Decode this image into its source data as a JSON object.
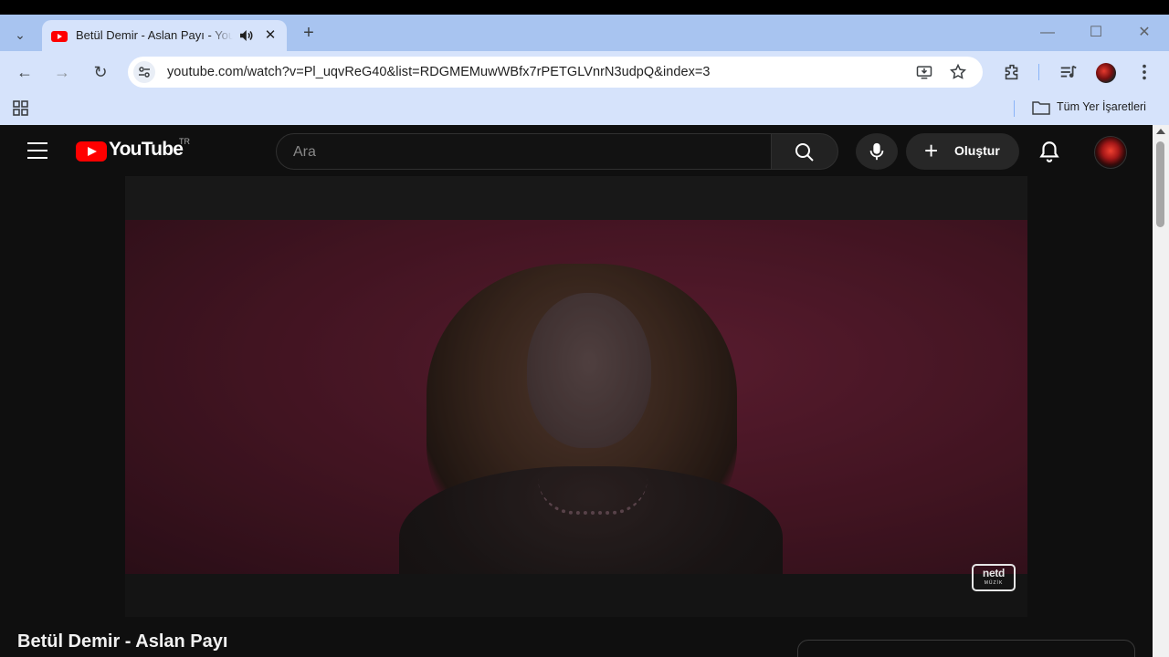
{
  "browser": {
    "tab": {
      "title": "Betül Demir - Aslan Payı - YouTube",
      "audio_icon": "speaker-icon",
      "close_glyph": "✕"
    },
    "new_tab_glyph": "+",
    "tab_list_glyph": "⌄",
    "window_controls": {
      "minimize": "—",
      "maximize": "☐",
      "close": "✕"
    },
    "nav": {
      "back": "←",
      "forward": "→",
      "reload": "↻"
    },
    "url": "youtube.com/watch?v=Pl_uqvReG40&list=RDGMEMuwWBfx7rPETGLVnrN3udpQ&index=3",
    "bookmarks_bar": {
      "folder_label": "Tüm Yer İşaretleri"
    },
    "colors": {
      "tabbar": "#a8c4f0",
      "toolbar": "#d6e3fb"
    }
  },
  "youtube": {
    "header": {
      "logo_text": "YouTube",
      "country_code": "TR",
      "search_placeholder": "Ara",
      "create_label": "Oluştur"
    },
    "video": {
      "title": "Betül Demir - Aslan Payı",
      "watermark_main": "netd",
      "watermark_sub": "MÜZİK"
    },
    "colors": {
      "background": "#0f0f0f",
      "brand_red": "#ff0000"
    }
  }
}
